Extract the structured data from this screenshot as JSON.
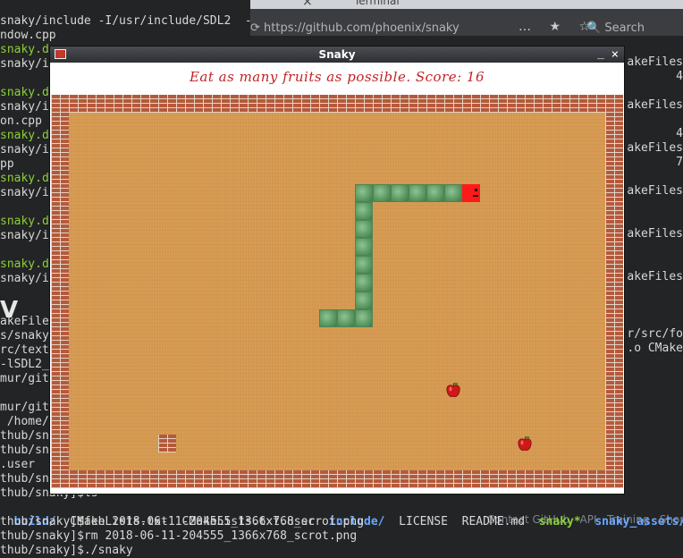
{
  "terminal": {
    "lines": [
      {
        "text": "snaky/include -I/usr/include/SDL2  -O3 -DNDEBUG   -pipe -march=native -std=gnu++14 -o CMakeFiles",
        "cls": ""
      },
      {
        "text": "ndow.cpp",
        "cls": ""
      },
      {
        "text": "snaky.d",
        "cls": "green"
      },
      {
        "text": "snaky/i",
        "cls": ""
      },
      {
        "text": "",
        "cls": ""
      },
      {
        "text": "snaky.d",
        "cls": "green"
      },
      {
        "text": "snaky/i",
        "cls": ""
      },
      {
        "text": "on.cpp",
        "cls": ""
      },
      {
        "text": "snaky.d",
        "cls": "green"
      },
      {
        "text": "snaky/i",
        "cls": ""
      },
      {
        "text": "pp",
        "cls": ""
      },
      {
        "text": "snaky.d",
        "cls": "green"
      },
      {
        "text": "snaky/i",
        "cls": ""
      },
      {
        "text": "",
        "cls": ""
      },
      {
        "text": "snaky.d",
        "cls": "green"
      },
      {
        "text": "snaky/i",
        "cls": ""
      },
      {
        "text": "",
        "cls": ""
      },
      {
        "text": "snaky.d",
        "cls": "green"
      },
      {
        "text": "snaky/i",
        "cls": ""
      },
      {
        "text": "",
        "cls": ""
      },
      {
        "text": "",
        "cls": ""
      },
      {
        "text": "akeFiles",
        "cls": ""
      },
      {
        "text": "s/snaky",
        "cls": ""
      },
      {
        "text": "rc/text",
        "cls": ""
      },
      {
        "text": "-lSDL2_",
        "cls": ""
      },
      {
        "text": "mur/git",
        "cls": ""
      },
      {
        "text": "",
        "cls": ""
      },
      {
        "text": "mur/gith",
        "cls": ""
      },
      {
        "text": " /home/p",
        "cls": ""
      },
      {
        "text": "thub/sna",
        "cls": ""
      },
      {
        "text": "thub/sna",
        "cls": ""
      },
      {
        "text": ".user  s",
        "cls": ""
      },
      {
        "text": "thub/sna",
        "cls": ""
      },
      {
        "text": "thub/snaky]$ls",
        "cls": ""
      }
    ],
    "right_fragments": [
      {
        "text": "akeFiles",
        "row": 4
      },
      {
        "text": "4",
        "row": 5
      },
      {
        "text": "akeFiles",
        "row": 7
      },
      {
        "text": "4",
        "row": 9
      },
      {
        "text": "akeFiles",
        "row": 10
      },
      {
        "text": "7",
        "row": 11
      },
      {
        "text": "akeFiles",
        "row": 13
      },
      {
        "text": "akeFiles",
        "row": 16
      },
      {
        "text": "akeFiles",
        "row": 19
      },
      {
        "text": "r/src/fo",
        "row": 23
      },
      {
        "text": ".o CMake",
        "row": 24
      }
    ],
    "ls_line": {
      "build": "build/",
      "cmakelists": "CMakeLists.txt",
      "cmakeuser": "CMakeLists.txt.user",
      "include": "include/",
      "license": "LICENSE",
      "readme": "README.md",
      "snaky": "snaky*",
      "assets": "snaky_assets/"
    },
    "cmd_feh": "thub/snaky]$feh 2018-06-11-204555_1366x768_scrot.png",
    "cmd_rm": "thub/snaky]$rm 2018-06-11-204555_1366x768_scrot.png",
    "cmd_run": "thub/snaky]$./snaky",
    "big_v": "V"
  },
  "browser": {
    "tab_close": "×",
    "tab_terminal": "Terminal",
    "url": "⟳  https://github.com/phoenix/snaky",
    "search": "🔍 Search",
    "nav_icons": "… ★ ☆"
  },
  "github_footer": "Contact GitHub   API   Training   Shop",
  "game": {
    "window_title": "Snaky",
    "minimize": "_",
    "close": "×",
    "message": "Eat as many fruits as possible. Score: 16",
    "score": 16,
    "grid": {
      "cols": 32,
      "rows": 22
    },
    "snake": {
      "head": [
        23,
        5
      ],
      "body": [
        [
          22,
          5
        ],
        [
          21,
          5
        ],
        [
          20,
          5
        ],
        [
          19,
          5
        ],
        [
          18,
          5
        ],
        [
          17,
          5
        ],
        [
          17,
          6
        ],
        [
          17,
          7
        ],
        [
          17,
          8
        ],
        [
          17,
          9
        ],
        [
          17,
          10
        ],
        [
          17,
          11
        ],
        [
          17,
          12
        ],
        [
          16,
          12
        ],
        [
          15,
          12
        ]
      ]
    },
    "fruits": [
      [
        22,
        16
      ],
      [
        26,
        19
      ]
    ],
    "obstacles": [
      [
        6,
        19
      ]
    ],
    "colors": {
      "snake_head": "#ff1a1a",
      "snake_body": "#5f9c66",
      "ground": "#d59950",
      "brick": "#b45a3c",
      "message": "#c22222"
    }
  }
}
